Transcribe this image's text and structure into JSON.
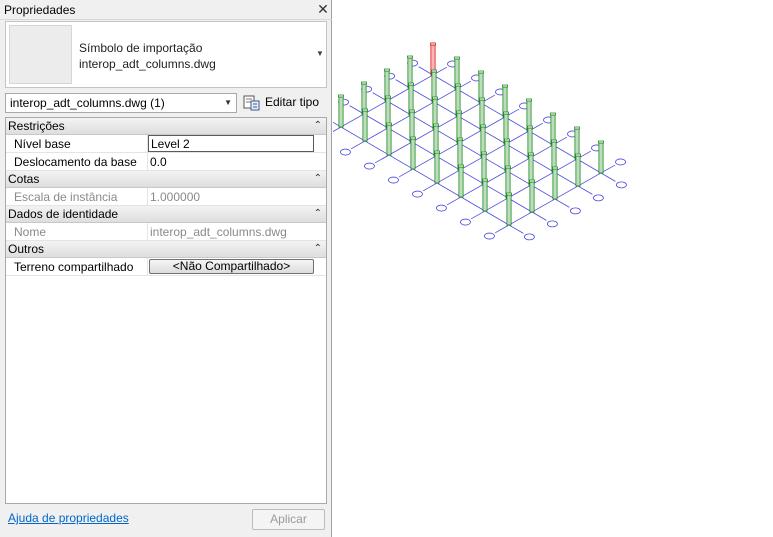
{
  "panel": {
    "title": "Propriedades",
    "close_icon": "close-icon"
  },
  "type_selector": {
    "line1": "Símbolo de importação",
    "line2": "interop_adt_columns.dwg",
    "arrow_icon": "dropdown-arrow-icon"
  },
  "instance_filter": {
    "value": "interop_adt_columns.dwg (1)"
  },
  "edit_type": {
    "label": "Editar tipo",
    "icon": "edit-type-icon"
  },
  "groups": [
    {
      "label": "Restrições",
      "rows": [
        {
          "label": "Nível base",
          "value": "Level 2"
        },
        {
          "label": "Deslocamento da base",
          "value": "0.0"
        }
      ]
    },
    {
      "label": "Cotas",
      "rows": [
        {
          "label": "Escala de instância",
          "value": "1.000000"
        }
      ]
    },
    {
      "label": "Dados de identidade",
      "rows": [
        {
          "label": "Nome",
          "value": "interop_adt_columns.dwg"
        }
      ]
    },
    {
      "label": "Outros",
      "rows": [
        {
          "label": "Terreno compartilhado",
          "value": "<Não Compartilhado>"
        }
      ]
    }
  ],
  "footer": {
    "help_link": "Ajuda de propriedades",
    "apply": "Aplicar"
  },
  "colors": {
    "grid": "#4a4ae0",
    "column": "#1e8a1e",
    "selected_column": "#e01010"
  }
}
